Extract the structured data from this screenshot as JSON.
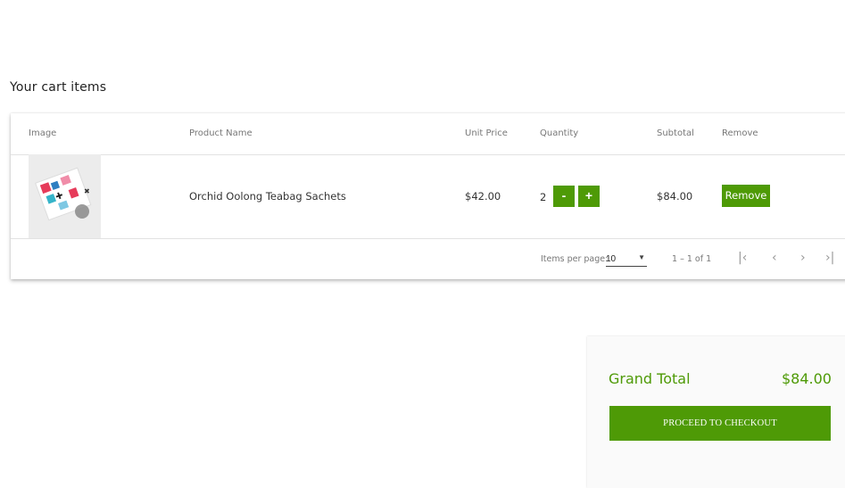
{
  "cart": {
    "heading": "Your cart items",
    "columns": {
      "image": "Image",
      "product_name": "Product Name",
      "unit_price": "Unit Price",
      "quantity": "Quantity",
      "subtotal": "Subtotal",
      "remove": "Remove"
    },
    "items": [
      {
        "product_name": "Orchid Oolong Teabag Sachets",
        "unit_price": "$42.00",
        "quantity": "2",
        "decrement_label": "-",
        "increment_label": "+",
        "subtotal": "$84.00",
        "remove_label": "Remove"
      }
    ],
    "paginator": {
      "items_per_page_label": "Items per page:",
      "items_per_page_value": "10",
      "range": "1 – 1 of 1",
      "first_icon": "first-page-icon",
      "prev_icon": "previous-page-icon",
      "next_icon": "next-page-icon",
      "last_icon": "last-page-icon"
    }
  },
  "summary": {
    "grand_total_label": "Grand Total",
    "grand_total_value": "$84.00",
    "checkout_label": "PROCEED TO CHECKOUT"
  },
  "colors": {
    "accent": "#4e9a06",
    "muted_text": "#777777"
  }
}
